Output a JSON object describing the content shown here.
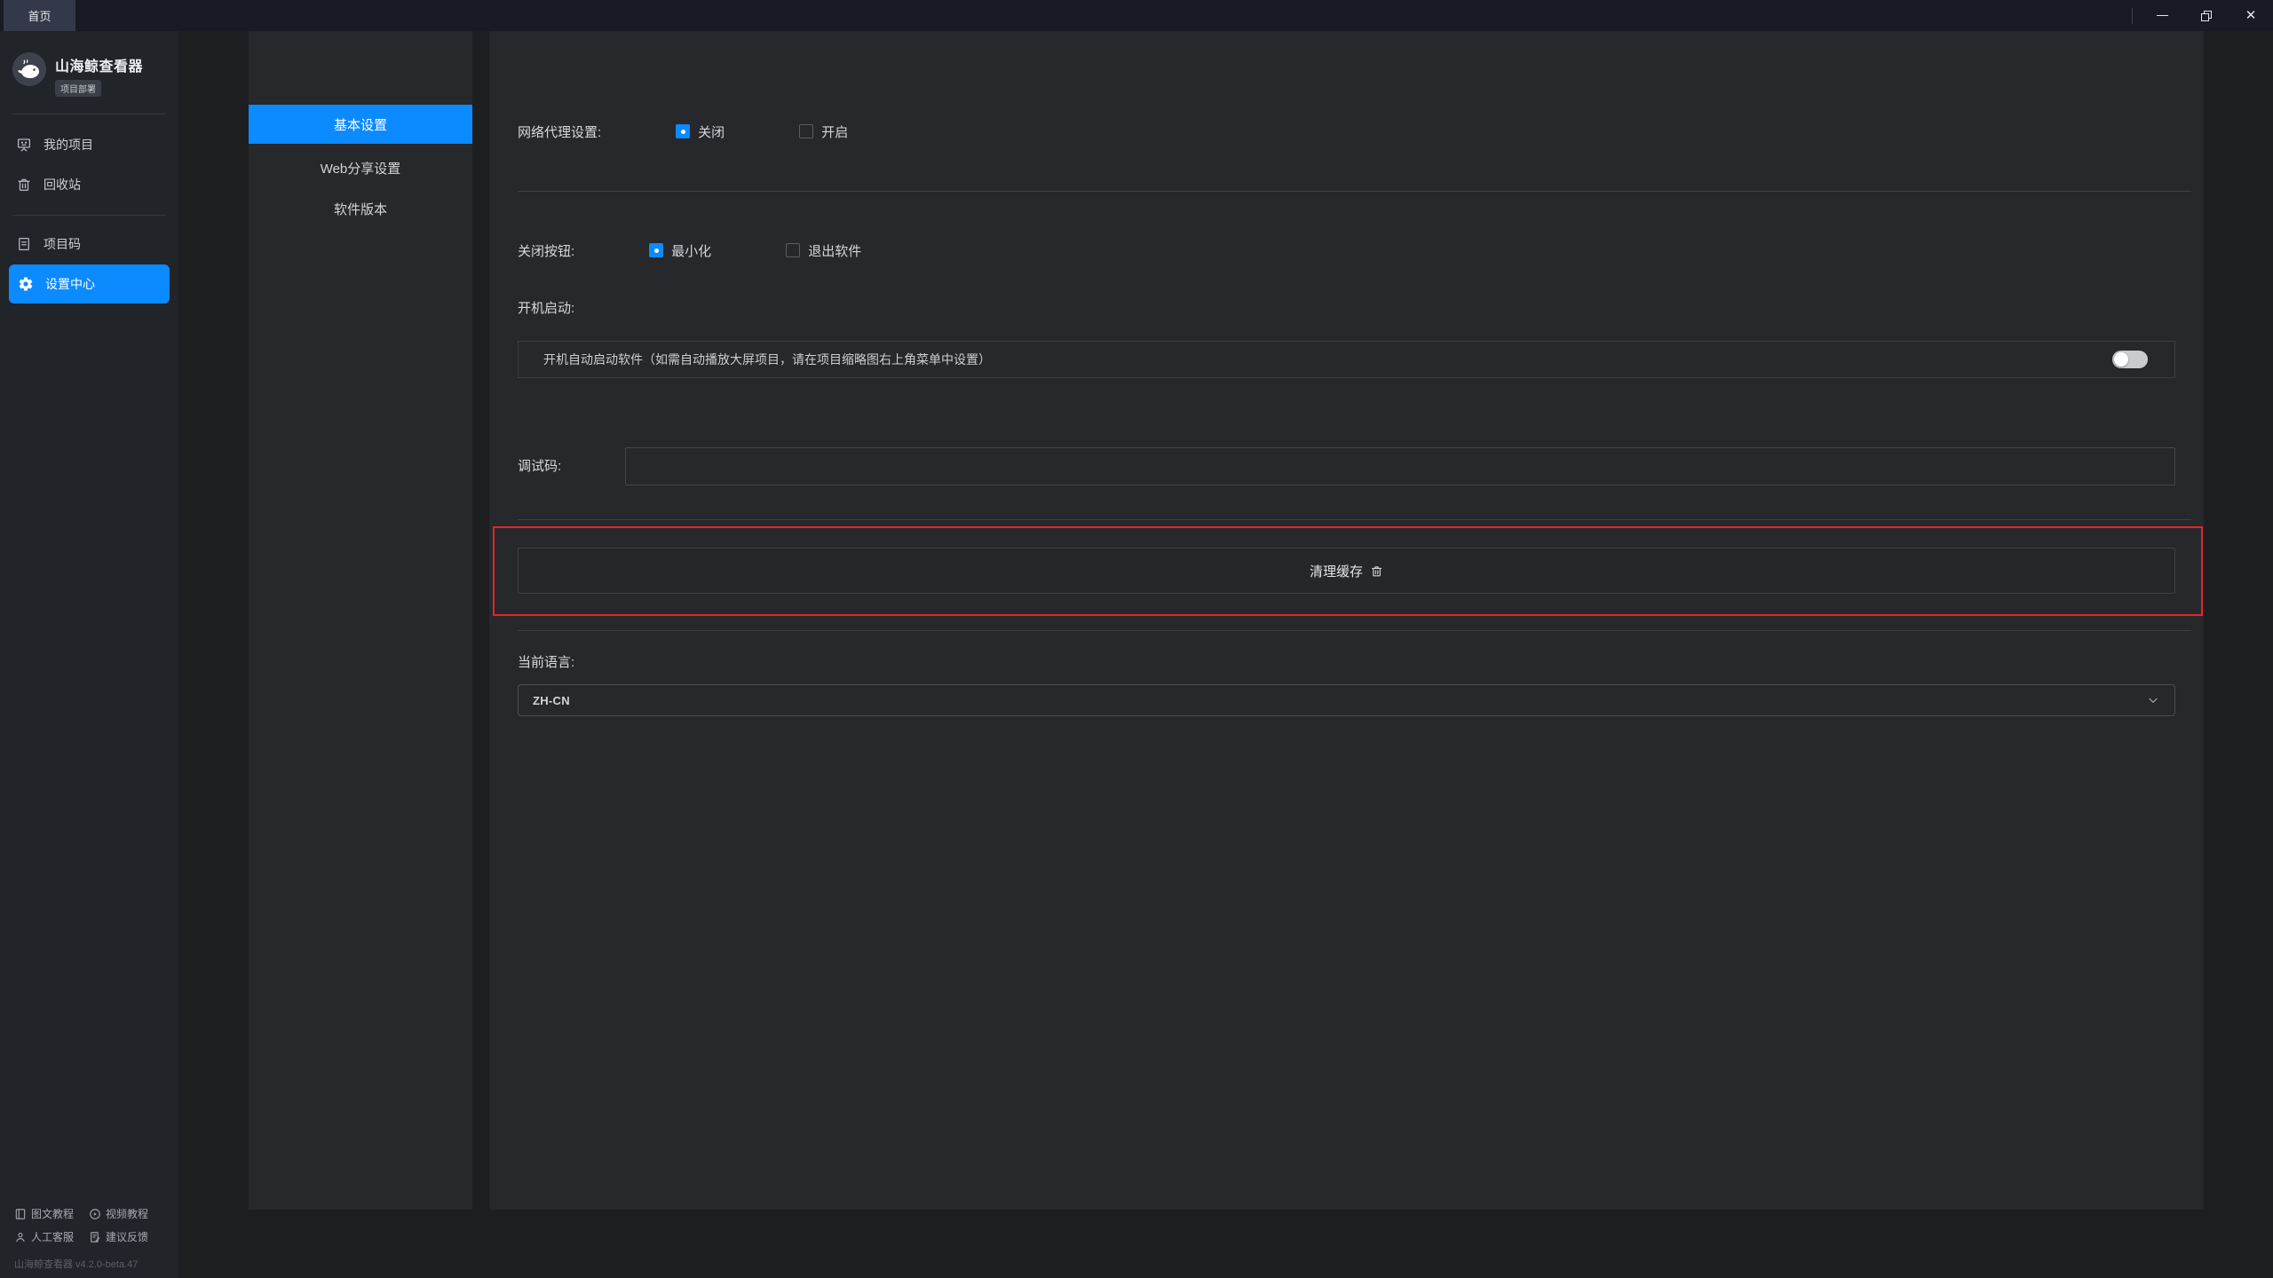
{
  "window": {
    "tab_label": "首页",
    "controls": {
      "minimize": "minimize",
      "restore": "restore",
      "close": "close"
    }
  },
  "sidebar": {
    "app_name": "山海鲸查看器",
    "app_badge": "项目部署",
    "items": [
      {
        "label": "我的项目",
        "icon": "projects-board-icon",
        "active": false
      },
      {
        "label": "回收站",
        "icon": "trash-icon",
        "active": false
      },
      {
        "label": "项目码",
        "icon": "project-code-icon",
        "active": false
      },
      {
        "label": "设置中心",
        "icon": "gear-icon",
        "active": true
      }
    ],
    "footer_links": [
      {
        "label": "图文教程",
        "icon": "book-icon"
      },
      {
        "label": "视频教程",
        "icon": "play-circle-icon"
      },
      {
        "label": "人工客服",
        "icon": "person-icon"
      },
      {
        "label": "建议反馈",
        "icon": "feedback-icon"
      }
    ],
    "version": "山海鲸查看器 v4.2.0-beta.47"
  },
  "settings_nav": {
    "items": [
      {
        "label": "基本设置",
        "active": true
      },
      {
        "label": "Web分享设置",
        "active": false
      },
      {
        "label": "软件版本",
        "active": false
      }
    ]
  },
  "settings": {
    "network_proxy": {
      "label": "网络代理设置:",
      "options": [
        {
          "label": "关闭",
          "selected": true
        },
        {
          "label": "开启",
          "selected": false
        }
      ]
    },
    "close_button": {
      "label": "关闭按钮:",
      "options": [
        {
          "label": "最小化",
          "selected": true
        },
        {
          "label": "退出软件",
          "selected": false
        }
      ]
    },
    "startup": {
      "label": "开机启动:",
      "description": "开机自动启动软件（如需自动播放大屏项目，请在项目缩略图右上角菜单中设置）",
      "toggle_on": false
    },
    "debug_code": {
      "label": "调试码:",
      "value": ""
    },
    "clear_cache": {
      "label": "清理缓存",
      "icon": "trash-icon"
    },
    "language": {
      "label": "当前语言:",
      "value": "ZH-CN"
    }
  },
  "colors": {
    "accent_blue": "#0c8aff",
    "annotation_red": "#e32526",
    "panel_bg": "#26282b",
    "sidebar_bg": "#212429",
    "topbar_bg": "#181b23"
  }
}
